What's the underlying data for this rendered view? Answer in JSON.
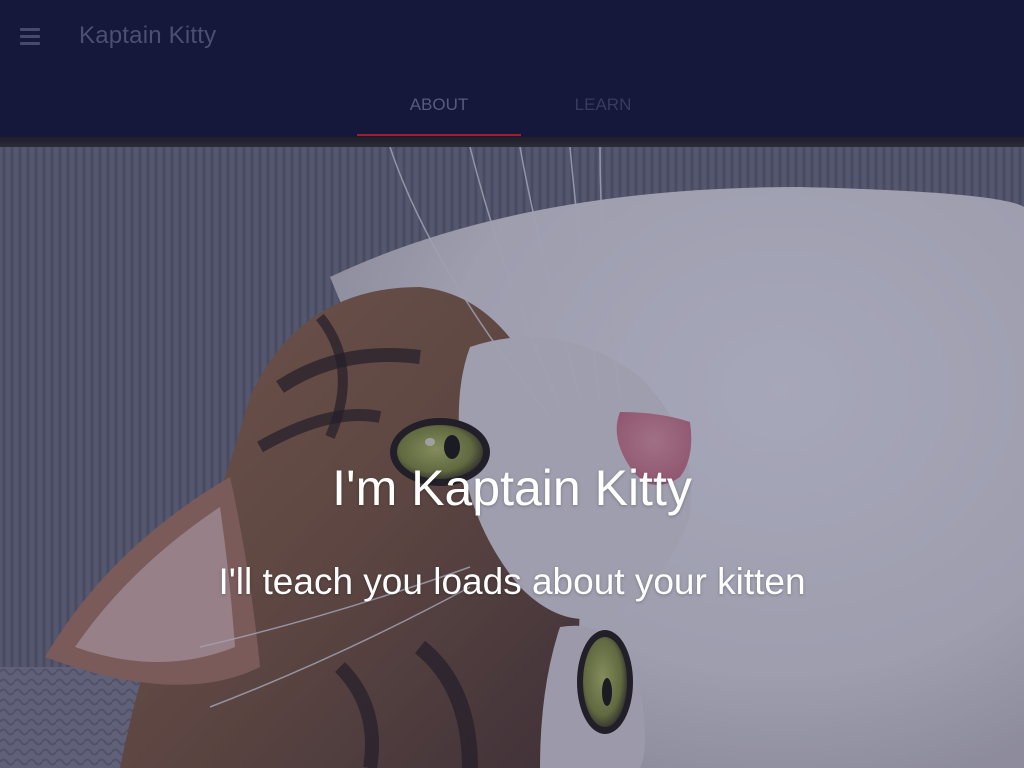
{
  "appbar": {
    "menu_icon": "hamburger-menu-icon",
    "title": "Kaptain Kitty",
    "background_color": "#15173b"
  },
  "tabs": [
    {
      "label": "ABOUT",
      "active": true
    },
    {
      "label": "LEARN",
      "active": false
    }
  ],
  "tab_indicator_color": "#a31c2a",
  "hero": {
    "image": "kitten-photo",
    "title": "I'm Kaptain Kitty",
    "subtitle": "I'll teach you loads about your kitten"
  }
}
